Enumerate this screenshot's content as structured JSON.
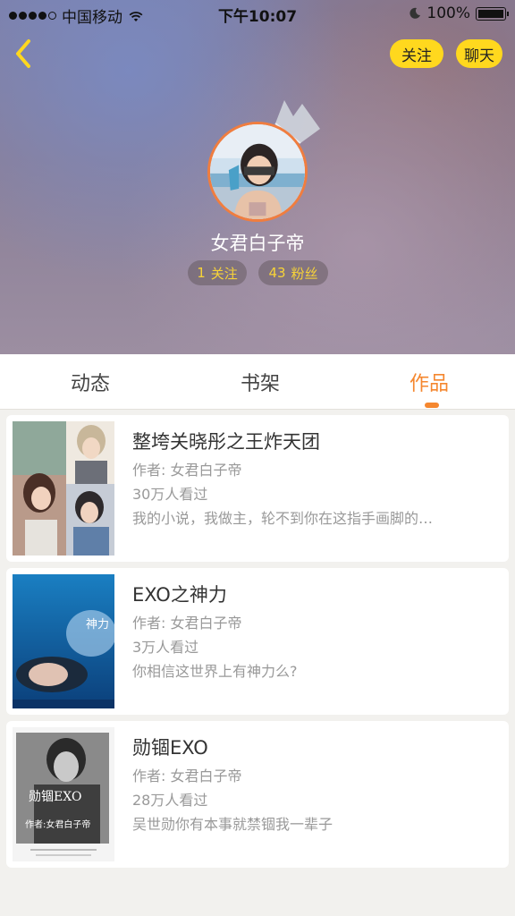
{
  "status_bar": {
    "carrier": "中国移动",
    "time": "下午10:07",
    "battery": "100%"
  },
  "header": {
    "follow_label": "关注",
    "chat_label": "聊天",
    "username": "女君白子帝",
    "following_count": "1",
    "following_label": "关注",
    "fans_count": "43",
    "fans_label": "粉丝"
  },
  "tabs": [
    {
      "label": "动态",
      "active": false
    },
    {
      "label": "书架",
      "active": false
    },
    {
      "label": "作品",
      "active": true
    }
  ],
  "works": [
    {
      "title": "整垮关晓彤之王炸天团",
      "author": "作者: 女君白子帝",
      "views": "30万人看过",
      "description": "我的小说，我做主，轮不到你在这指手画脚的…"
    },
    {
      "title": "EXO之神力",
      "author": "作者: 女君白子帝",
      "views": "3万人看过",
      "description": "你相信这世界上有神力么?"
    },
    {
      "title": "勋锢EXO",
      "author": "作者: 女君白子帝",
      "views": "28万人看过",
      "description": "吴世勋你有本事就禁锢我一辈子"
    }
  ],
  "cover_text": {
    "cover2_title": "神力",
    "cover3_title": "勋锢EXO",
    "cover3_author": "作者:女君白子帝"
  },
  "colors": {
    "accent": "#f5872f",
    "button_yellow": "#ffd81e",
    "stat_yellow": "#f7d338"
  }
}
